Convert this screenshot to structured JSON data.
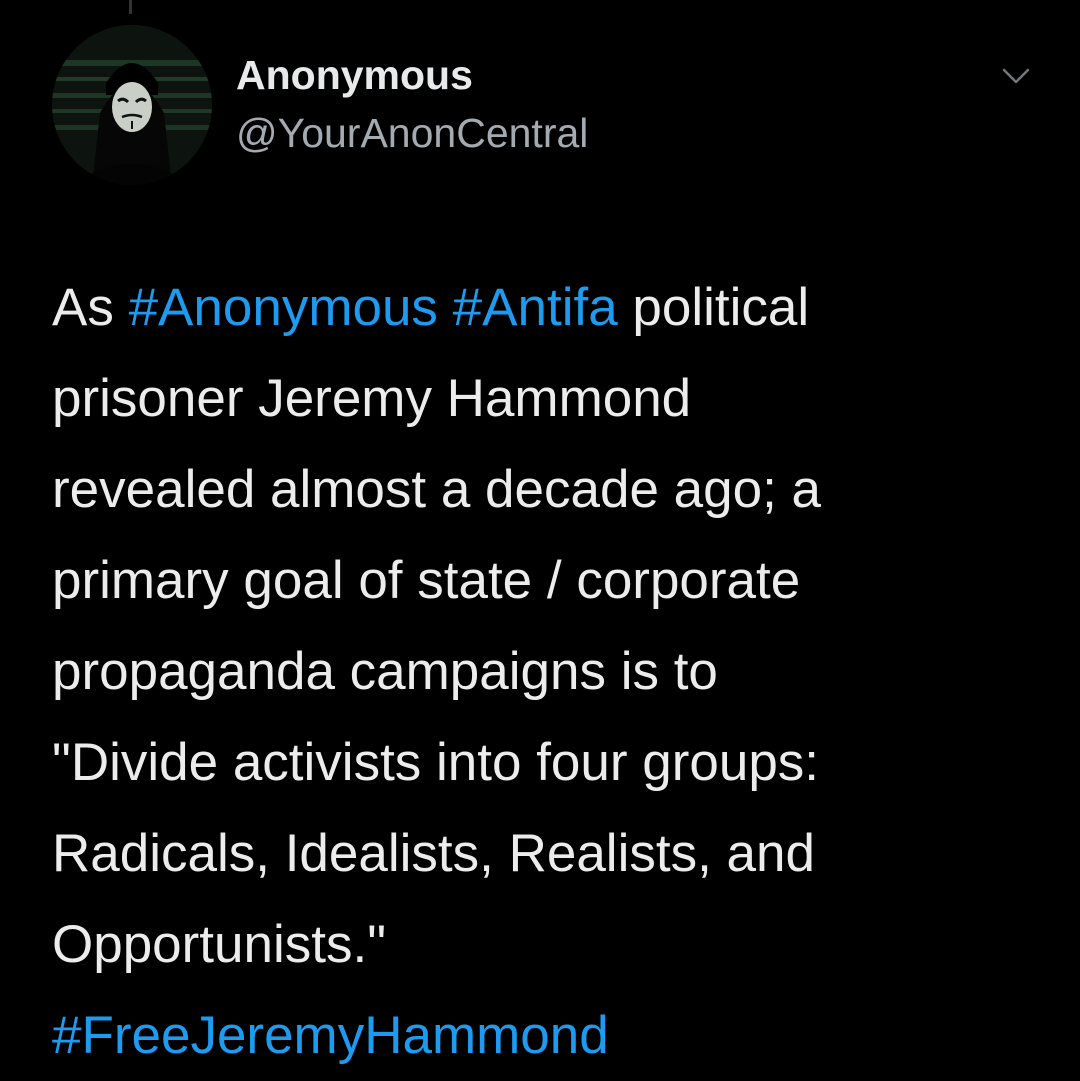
{
  "account": {
    "display_name": "Anonymous",
    "handle": "@YourAnonCentral",
    "avatar_icon": "anonymous-mask-avatar"
  },
  "menu": {
    "icon": "chevron-down-icon"
  },
  "tweet": {
    "lines": [
      {
        "parts": [
          {
            "text": "As ",
            "type": "text"
          },
          {
            "text": "#Anonymous",
            "type": "hashtag"
          },
          {
            "text": " ",
            "type": "text"
          },
          {
            "text": "#Antifa",
            "type": "hashtag"
          },
          {
            "text": " political",
            "type": "text"
          }
        ]
      },
      {
        "parts": [
          {
            "text": "prisoner Jeremy Hammond",
            "type": "text"
          }
        ]
      },
      {
        "parts": [
          {
            "text": "revealed almost a decade ago; a",
            "type": "text"
          }
        ]
      },
      {
        "parts": [
          {
            "text": "primary goal of state / corporate",
            "type": "text"
          }
        ]
      },
      {
        "parts": [
          {
            "text": "propaganda campaigns is to",
            "type": "text"
          }
        ]
      },
      {
        "parts": [
          {
            "text": "\"Divide activists into four groups:",
            "type": "text"
          }
        ]
      },
      {
        "parts": [
          {
            "text": "Radicals, Idealists, Realists, and",
            "type": "text"
          }
        ]
      },
      {
        "parts": [
          {
            "text": "Opportunists.\"",
            "type": "text"
          }
        ]
      },
      {
        "parts": [
          {
            "text": "#FreeJeremyHammond",
            "type": "hashtag"
          }
        ]
      }
    ]
  },
  "colors": {
    "background": "#000000",
    "text": "#ececec",
    "handle": "#a3aab0",
    "link": "#1d9bf0"
  }
}
